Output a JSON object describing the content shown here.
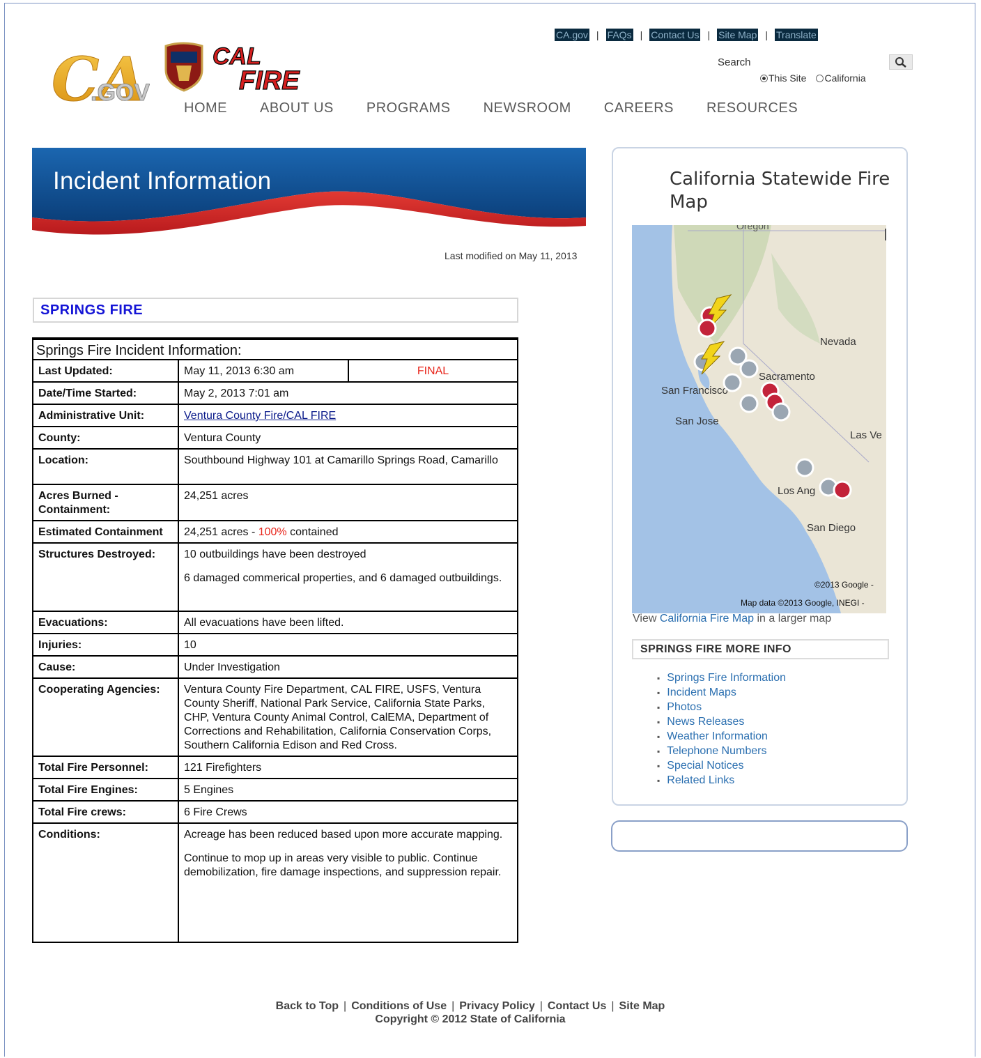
{
  "utility_links": [
    "CA.gov",
    "FAQs",
    "Contact Us",
    "Site Map",
    "Translate"
  ],
  "logos": {
    "ca_gov_text": "CA.GOV",
    "calfire_line1": "CAL",
    "calfire_line2": "FIRE"
  },
  "search": {
    "label": "Search",
    "scope_this_site": "This Site",
    "scope_california": "California",
    "selected_scope": "This Site",
    "button_icon": "search-icon"
  },
  "nav": [
    "HOME",
    "ABOUT US",
    "PROGRAMS",
    "NEWSROOM",
    "CAREERS",
    "RESOURCES"
  ],
  "banner": {
    "title": "Incident Information"
  },
  "last_modified": "Last modified on May 11, 2013",
  "fire_name": "SPRINGS FIRE",
  "table": {
    "caption": "Springs Fire Incident Information:",
    "last_updated_label": "Last Updated:",
    "last_updated_value": "May 11, 2013 6:30 am",
    "status": "FINAL",
    "date_started_label": "Date/Time Started:",
    "date_started_value": "May 2, 2013 7:01 am",
    "admin_unit_label": "Administrative Unit:",
    "admin_unit_value": "Ventura County Fire/CAL FIRE",
    "county_label": "County:",
    "county_value": "Ventura County",
    "location_label": "Location:",
    "location_value": "Southbound Highway 101 at Camarillo Springs Road, Camarillo",
    "acres_label": "Acres Burned - Containment:",
    "acres_value": "24,251 acres",
    "containment_label": "Estimated Containment",
    "containment_acres": "24,251 acres - ",
    "containment_pct": "100%",
    "containment_suffix": " contained",
    "structures_label": "Structures Destroyed:",
    "structures_value_1": "10 outbuildings have been destroyed",
    "structures_value_2": "6 damaged commerical properties, and 6 damaged outbuildings.",
    "evacuations_label": "Evacuations:",
    "evacuations_value": "All evacuations have been lifted.",
    "injuries_label": "Injuries:",
    "injuries_value": "10",
    "cause_label": "Cause:",
    "cause_value": "Under Investigation",
    "agencies_label": "Cooperating Agencies:",
    "agencies_value": "Ventura County Fire Department, CAL FIRE, USFS, Ventura County Sheriff, National Park Service, California State Parks, CHP, Ventura County Animal Control, CalEMA, Department of Corrections and Rehabilitation, California Conservation Corps, Southern California Edison and Red Cross.",
    "personnel_label": "Total Fire Personnel:",
    "personnel_value": "121 Firefighters",
    "engines_label": "Total Fire Engines:",
    "engines_value": "5 Engines",
    "crews_label": "Total Fire crews:",
    "crews_value": "6 Fire Crews",
    "conditions_label": "Conditions:",
    "conditions_value_1": "Acreage has been reduced based upon more accurate mapping.",
    "conditions_value_2": "Continue to mop up in areas very visible to public. Continue demobilization, fire damage inspections, and suppression repair."
  },
  "sidebar": {
    "map_title": "California Statewide Fire Map",
    "map_labels": {
      "oregon": "Oregon",
      "nevada": "Nevada",
      "sacramento": "Sacramento",
      "san_francisco": "San Francisco",
      "san_jose": "San Jose",
      "las_vegas": "Las Ve",
      "los_angeles": "Los Ang",
      "san_diego": "San Diego",
      "copyright": "©2013 Google -",
      "map_data": "Map data ©2013 Google, INEGI -"
    },
    "view_prefix": "View ",
    "view_link": "California Fire Map",
    "view_suffix": " in a larger map",
    "more_info_title": "SPRINGS FIRE MORE INFO",
    "more_links": [
      "Springs Fire Information",
      "Incident Maps",
      "Photos",
      "News Releases",
      "Weather Information",
      "Telephone Numbers",
      "Special Notices",
      "Related Links"
    ]
  },
  "footer": {
    "links": [
      "Back to Top",
      "Conditions of Use",
      "Privacy Policy",
      "Contact Us",
      "Site Map"
    ],
    "copyright": "Copyright © 2012 State of California"
  },
  "colors": {
    "utility_bg": "#0a2a3f",
    "banner_blue": "#0e4f8f",
    "banner_red": "#d8262a",
    "fire_name_blue": "#1515d6",
    "final_red": "#e8251b",
    "link_blue": "#2b6fb0"
  }
}
